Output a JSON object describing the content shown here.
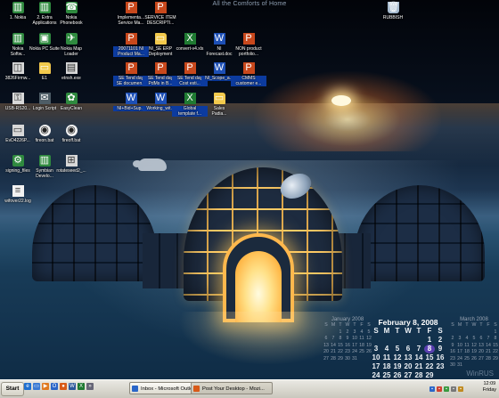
{
  "wallpaper": {
    "title": "All the Comforts of Home",
    "watermark": "WinRUS"
  },
  "icons": [
    {
      "id": "nokia1",
      "label": "1. Nokia",
      "glyph": "▥",
      "kind": "app"
    },
    {
      "id": "extra-apps",
      "label": "2. Extra\nApplications",
      "glyph": "▥",
      "kind": "app"
    },
    {
      "id": "nokia-phonebook",
      "label": "Nokia\nPhonebook",
      "glyph": "☎",
      "kind": "app"
    },
    {
      "id": "service-mgmt",
      "label": "Implementa...\nService Ma...",
      "glyph": "P",
      "kind": "ppt"
    },
    {
      "id": "service-item",
      "label": "SERVICE ITEM\nDESCRIPTI...",
      "glyph": "P",
      "kind": "ppt"
    },
    {
      "id": "rubbish",
      "label": "RUBBISH",
      "glyph": "🗑",
      "kind": "bin"
    },
    {
      "id": "nokia-software",
      "label": "Nokia\nSoftw...",
      "glyph": "▥",
      "kind": "app"
    },
    {
      "id": "nokia-pc-suite",
      "label": "Nokia PC Suite",
      "glyph": "▣",
      "kind": "app"
    },
    {
      "id": "nokia-map-loader",
      "label": "Nokia Map\nLoader",
      "glyph": "✈",
      "kind": "app"
    },
    {
      "id": "product-mgmt",
      "label": "20071101 NI\nProduct Ma...",
      "glyph": "P",
      "kind": "ppt"
    },
    {
      "id": "se-erp",
      "label": "NI_SE ERP\nDeployment",
      "glyph": "▭",
      "kind": "folder"
    },
    {
      "id": "convert-xls",
      "label": "convert-v4.xls",
      "glyph": "X",
      "kind": "xls"
    },
    {
      "id": "ni-forecast",
      "label": "NI\nForecast.doc",
      "glyph": "W",
      "kind": "doc"
    },
    {
      "id": "non-product",
      "label": "NON product\nportfolio...",
      "glyph": "P",
      "kind": "ppt"
    },
    {
      "id": "firmware",
      "label": "3826Firmw...",
      "glyph": "◫",
      "kind": "exe"
    },
    {
      "id": "e1",
      "label": "E1",
      "glyph": "▭",
      "kind": "folder"
    },
    {
      "id": "etnish",
      "label": "etnsh.exe",
      "glyph": "▤",
      "kind": "exe"
    },
    {
      "id": "tend-doc1",
      "label": "SE Tend day\nSE documen...",
      "glyph": "P",
      "kind": "ppt"
    },
    {
      "id": "tend-doc2",
      "label": "SE Tend day\nPdMs in B...",
      "glyph": "P",
      "kind": "ppt"
    },
    {
      "id": "tend-doc3",
      "label": "SE Tend day\nCost esti...",
      "glyph": "P",
      "kind": "ppt"
    },
    {
      "id": "scope",
      "label": "NI_Scope_a...",
      "glyph": "W",
      "kind": "doc"
    },
    {
      "id": "cmms",
      "label": "CMMS\ncustomer e...",
      "glyph": "P",
      "kind": "ppt"
    },
    {
      "id": "usb",
      "label": "USB-RS20...",
      "glyph": "⚿",
      "kind": "exe"
    },
    {
      "id": "login-script",
      "label": "Login Script",
      "glyph": "✉",
      "kind": "bat"
    },
    {
      "id": "easy-clean",
      "label": "EasyClean",
      "glyph": "✿",
      "kind": "app"
    },
    {
      "id": "ni-sup",
      "label": "NI+Bid+Sup...",
      "glyph": "W",
      "kind": "doc"
    },
    {
      "id": "working-wit",
      "label": "Working_wit...",
      "glyph": "W",
      "kind": "doc"
    },
    {
      "id": "global-template",
      "label": "Global\ntemplate f...",
      "glyph": "X",
      "kind": "xls"
    },
    {
      "id": "sales-padia",
      "label": "Sales\nPadia...",
      "glyph": "▭",
      "kind": "folder"
    },
    {
      "id": "evd-file",
      "label": "EvD4226P...",
      "glyph": "▭",
      "kind": "exe"
    },
    {
      "id": "fireon",
      "label": "fireon.bat",
      "glyph": "◉",
      "kind": "eye"
    },
    {
      "id": "fireoff",
      "label": "fireoff.bat",
      "glyph": "◉",
      "kind": "eye"
    },
    {
      "id": "signing-files",
      "label": "signing_files",
      "glyph": "⚙",
      "kind": "app"
    },
    {
      "id": "symbian",
      "label": "Symbian\nDevelo...",
      "glyph": "▥",
      "kind": "app"
    },
    {
      "id": "rotate",
      "label": "rotateseed2_...",
      "glyph": "⊞",
      "kind": "exe"
    },
    {
      "id": "wiftover",
      "label": "wifover22.log",
      "glyph": "≡",
      "kind": "blank"
    }
  ],
  "calendar": {
    "january": {
      "title": "January 2008",
      "days": [
        "S",
        "M",
        "T",
        "W",
        "T",
        "F",
        "S",
        "",
        "",
        "1",
        "2",
        "3",
        "4",
        "5",
        "6",
        "7",
        "8",
        "9",
        "10",
        "11",
        "12",
        "13",
        "14",
        "15",
        "16",
        "17",
        "18",
        "19",
        "20",
        "21",
        "22",
        "23",
        "24",
        "25",
        "26",
        "27",
        "28",
        "29",
        "30",
        "31",
        "",
        ""
      ]
    },
    "february": {
      "title": "February 8, 2008",
      "today": "8",
      "days": [
        "S",
        "M",
        "T",
        "W",
        "T",
        "F",
        "S",
        "",
        "",
        "",
        "",
        "",
        "1",
        "2",
        "3",
        "4",
        "5",
        "6",
        "7",
        "8",
        "9",
        "10",
        "11",
        "12",
        "13",
        "14",
        "15",
        "16",
        "17",
        "18",
        "19",
        "20",
        "21",
        "22",
        "23",
        "24",
        "25",
        "26",
        "27",
        "28",
        "29",
        ""
      ]
    },
    "march": {
      "title": "March 2008",
      "days": [
        "S",
        "M",
        "T",
        "W",
        "T",
        "F",
        "S",
        "",
        "",
        "",
        "",
        "",
        "",
        "1",
        "2",
        "3",
        "4",
        "5",
        "6",
        "7",
        "8",
        "9",
        "10",
        "11",
        "12",
        "13",
        "14",
        "15",
        "16",
        "17",
        "18",
        "19",
        "20",
        "21",
        "22",
        "23",
        "24",
        "25",
        "26",
        "27",
        "28",
        "29",
        "30",
        "31",
        "",
        "",
        "",
        "",
        ""
      ]
    }
  },
  "taskbar": {
    "start_label": "Start",
    "quick_launch": [
      {
        "name": "ie-icon",
        "glyph": "e",
        "color": "#1f6fd0"
      },
      {
        "name": "desktop-icon",
        "glyph": "▭",
        "color": "#3b7bd4"
      },
      {
        "name": "media-icon",
        "glyph": "▶",
        "color": "#e07a20"
      },
      {
        "name": "outlook-icon",
        "glyph": "O",
        "color": "#2a66c8"
      },
      {
        "name": "firefox-icon",
        "glyph": "●",
        "color": "#d85a18"
      },
      {
        "name": "word-icon",
        "glyph": "W",
        "color": "#2b579a"
      },
      {
        "name": "excel-icon",
        "glyph": "X",
        "color": "#1f7a32"
      },
      {
        "name": "more-icon",
        "glyph": "»",
        "color": "#667"
      }
    ],
    "tasks": [
      {
        "label": "Inbox - Microsoft Outlook",
        "color": "#2a66c8"
      },
      {
        "label": "Post Your Desktop - Mozi...",
        "color": "#d85a18"
      }
    ],
    "clock": {
      "time": "12:09",
      "day": "Friday"
    }
  }
}
